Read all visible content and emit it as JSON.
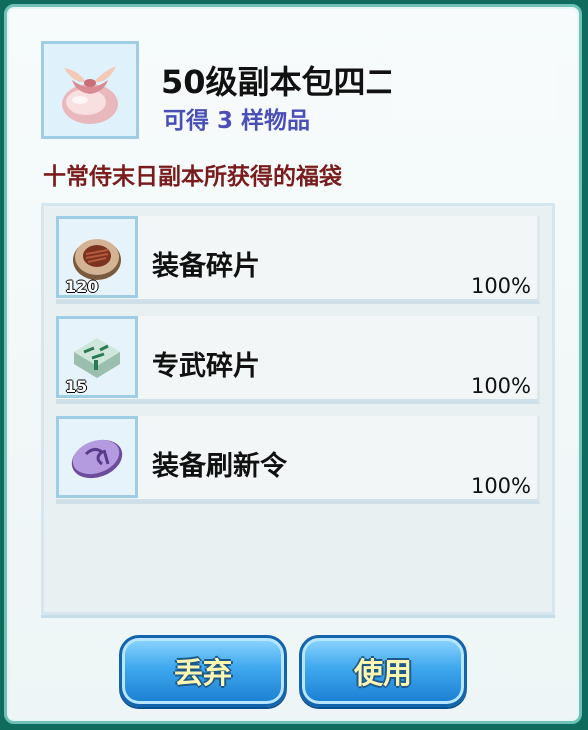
{
  "item": {
    "title": "50级副本包四二",
    "subtitle": "可得 3 样物品",
    "description": "十常侍末日副本所获得的福袋",
    "icon": "lucky-bag-icon"
  },
  "rewards": [
    {
      "name": "装备碎片",
      "quantity": "120",
      "chance": "100%",
      "icon": "equipment-fragment-icon"
    },
    {
      "name": "专武碎片",
      "quantity": "15",
      "chance": "100%",
      "icon": "exclusive-weapon-fragment-icon"
    },
    {
      "name": "装备刷新令",
      "quantity": "",
      "chance": "100%",
      "icon": "equipment-refresh-token-icon"
    }
  ],
  "buttons": {
    "discard": "丢弃",
    "use": "使用"
  },
  "colors": {
    "frame": "#0f6b5c",
    "subtitle": "#4a4fb8",
    "description": "#7a1c1c",
    "button": "#3fa8ee"
  }
}
